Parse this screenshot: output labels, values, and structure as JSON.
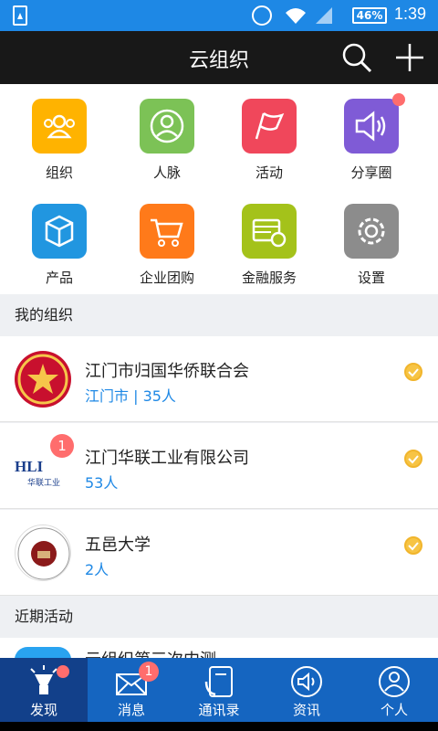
{
  "status_bar": {
    "battery": "46%",
    "time": "1:39"
  },
  "header": {
    "title": "云组织"
  },
  "grid": [
    {
      "label": "组织",
      "icon": "group-icon",
      "color": "#ffb300"
    },
    {
      "label": "人脉",
      "icon": "person-icon",
      "color": "#7cc256"
    },
    {
      "label": "活动",
      "icon": "flag-icon",
      "color": "#f0475b"
    },
    {
      "label": "分享圈",
      "icon": "speaker-icon",
      "color": "#7f5bd6"
    },
    {
      "label": "产品",
      "icon": "cube-icon",
      "color": "#2196e0"
    },
    {
      "label": "企业团购",
      "icon": "cart-icon",
      "color": "#ff7a1a"
    },
    {
      "label": "金融服务",
      "icon": "card-coin-icon",
      "color": "#a4c21a"
    },
    {
      "label": "设置",
      "icon": "gear-icon",
      "color": "#8c8c8c"
    }
  ],
  "sections": {
    "my_org": "我的组织",
    "recent": "近期活动"
  },
  "orgs": [
    {
      "name": "江门市归国华侨联合会",
      "sub": "江门市 | 35人",
      "logo": "red-star-emblem"
    },
    {
      "name": "江门华联工业有限公司",
      "sub": "53人",
      "logo": "hli-logo",
      "logo_text": "HLI",
      "logo_cn": "华联工业",
      "badge": "1"
    },
    {
      "name": "五邑大学",
      "sub": "2人",
      "logo": "university-seal"
    }
  ],
  "recent_activity": {
    "title": "云组织第三次内测"
  },
  "tabs": [
    {
      "label": "发现",
      "icon": "discover-icon",
      "active": true
    },
    {
      "label": "消息",
      "icon": "envelope-icon",
      "badge": "1"
    },
    {
      "label": "通讯录",
      "icon": "contacts-icon"
    },
    {
      "label": "资讯",
      "icon": "news-icon"
    },
    {
      "label": "个人",
      "icon": "user-icon"
    }
  ]
}
